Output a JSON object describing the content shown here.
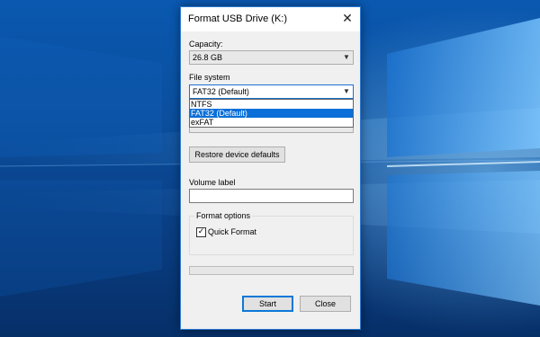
{
  "window": {
    "title": "Format USB Drive (K:)",
    "close_glyph": "✕"
  },
  "capacity": {
    "label": "Capacity:",
    "value": "26.8 GB"
  },
  "file_system": {
    "label": "File system",
    "value": "FAT32 (Default)",
    "options": [
      "NTFS",
      "FAT32 (Default)",
      "exFAT"
    ],
    "selected_index": 1
  },
  "buttons": {
    "restore_defaults": "Restore device defaults",
    "start": "Start",
    "close": "Close"
  },
  "volume_label": {
    "label": "Volume label",
    "value": ""
  },
  "format_options": {
    "title": "Format options",
    "quick_format_label": "Quick Format",
    "quick_format_checked": true,
    "check_glyph": "✓"
  },
  "progress": {
    "value": 0
  },
  "icons": {
    "dropdown": "chevron-down-icon",
    "close": "close-icon",
    "check": "checkmark-icon"
  },
  "colors": {
    "accent": "#0a6fd8",
    "window_border": "#2b79d0",
    "dialog_bg": "#f0f0f0"
  }
}
